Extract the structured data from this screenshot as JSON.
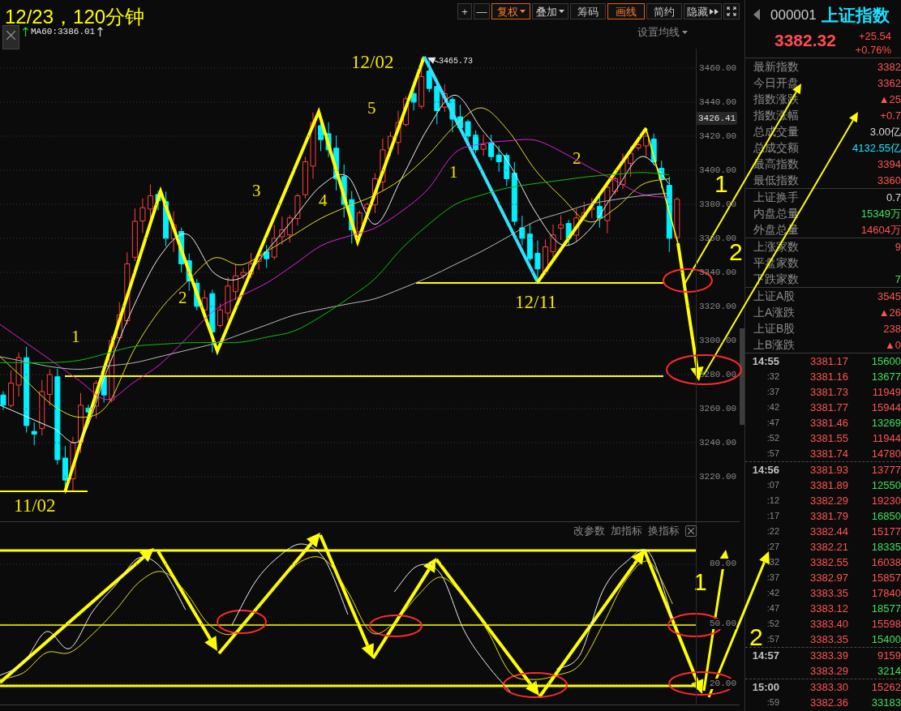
{
  "chart_title": "12/23，120分钟",
  "toolbar": {
    "buttons": [
      {
        "label": "+",
        "kind": "plain",
        "selected": false
      },
      {
        "label": "—",
        "kind": "plain",
        "selected": false
      },
      {
        "label": "复权",
        "kind": "dropdown",
        "selected": true
      },
      {
        "label": "叠加",
        "kind": "dropdown",
        "selected": false
      },
      {
        "label": "筹码",
        "kind": "plain",
        "selected": false
      },
      {
        "label": "画线",
        "kind": "plain",
        "selected": true
      },
      {
        "label": "简约",
        "kind": "plain",
        "selected": false
      },
      {
        "label": "隐藏",
        "kind": "expand",
        "selected": false
      }
    ]
  },
  "ma_legend": {
    "text": "MA60:3386.01",
    "settings_label": "设置均线"
  },
  "price_chart": {
    "chart_data": {
      "type": "line",
      "grid": true,
      "categories": [
        null,
        null,
        null,
        null,
        null,
        null,
        null,
        null,
        null,
        null,
        null,
        null,
        null,
        null,
        null,
        null,
        null,
        null,
        null,
        null,
        null,
        null,
        null,
        null,
        null,
        null,
        null
      ],
      "ylim": [
        3193.81,
        3471.43
      ],
      "yticks": [
        {
          "value": 3460,
          "label": "3460.00"
        },
        {
          "value": 3440,
          "label": "3440.00"
        },
        {
          "value": 3420,
          "label": "3420.00"
        },
        {
          "value": 3400,
          "label": "3400.00"
        },
        {
          "value": 3380,
          "label": "3380.00"
        },
        {
          "value": 3360,
          "label": "3360.00"
        },
        {
          "value": 3340,
          "label": "3340.00"
        },
        {
          "value": 3320,
          "label": "3320.00"
        },
        {
          "value": 3300,
          "label": "3300.00"
        },
        {
          "value": 3280,
          "label": "3280.00"
        },
        {
          "value": 3260,
          "label": "3260.00"
        },
        {
          "value": 3240,
          "label": "3240.00"
        },
        {
          "value": 3220,
          "label": "3220.00"
        }
      ],
      "series": [
        {
          "color": "#f0f0f0",
          "values": [
            3262,
            3255.2,
            3248.4,
            3241.6,
            3282.5,
            3320.3,
            3350.1,
            3362.4,
            3339.6,
            3336.7,
            3353.3,
            3372.1,
            3390.9,
            3396.2,
            3368.3,
            3395.1,
            3425,
            3444.1,
            3424.1,
            3404.5,
            3375.7,
            3356.2,
            3364.6,
            3388,
            3408.1,
            3392,
            null
          ]
        },
        {
          "color": "#e8e020",
          "values": [
            3290.5,
            3276,
            3261.7,
            3254.9,
            3261.8,
            3294.3,
            3318.4,
            3334.7,
            3348.5,
            3344.4,
            3352.7,
            3362.3,
            3371.8,
            3378.8,
            3385.4,
            3394.9,
            3409,
            3426.1,
            3436.6,
            3423,
            3400.2,
            3383.9,
            3369.7,
            3377.7,
            3391.6,
            3395,
            null
          ]
        },
        {
          "color": "#e020e0",
          "values": [
            3309.5,
            3298.4,
            3287.3,
            3276,
            3265.3,
            3275.5,
            3286.3,
            3301.8,
            3317.6,
            3326.2,
            3334.1,
            3344.7,
            3355.7,
            3361.2,
            3366,
            3375.8,
            3389.1,
            3410.2,
            3415.5,
            3417.3,
            3417.6,
            3410.7,
            3401.9,
            3393.8,
            3385.9,
            3384,
            null
          ]
        },
        {
          "color": "#b8b8b8",
          "values": [
            3290.5,
            3287.4,
            3284.4,
            3283.1,
            3285,
            3286.9,
            3290.6,
            3294.4,
            3298.2,
            3303.7,
            3309.4,
            3315,
            3318.4,
            3321.5,
            3324.5,
            3330.5,
            3337,
            3344.6,
            3352.4,
            3361.1,
            3370,
            3375,
            3380,
            3382.8,
            3385.1,
            3386.6,
            null
          ]
        },
        {
          "color": "#10c010",
          "values": [
            3287,
            3287,
            3287,
            3288.5,
            3292.5,
            3296.5,
            3297.8,
            3298.7,
            3298.8,
            3299,
            3302.1,
            3305.6,
            3314.2,
            3324.6,
            3336.2,
            3353.8,
            3368,
            3379.8,
            3385.5,
            3389.7,
            3392.2,
            3394.2,
            3396.3,
            3397.6,
            3398.7,
            3397.3,
            null
          ]
        }
      ]
    },
    "current_price": "3426.41"
  },
  "chart_annotations": [
    {
      "text": "12/02",
      "kind": "date"
    },
    {
      "text": "3465.73",
      "kind": "peak"
    },
    {
      "text": "5",
      "kind": "wave"
    },
    {
      "text": "3",
      "kind": "wave"
    },
    {
      "text": "4",
      "kind": "wave"
    },
    {
      "text": "1",
      "kind": "wave"
    },
    {
      "text": "2",
      "kind": "wave"
    },
    {
      "text": "1",
      "kind": "scenario"
    },
    {
      "text": "2",
      "kind": "wave"
    },
    {
      "text": "2",
      "kind": "scenario"
    },
    {
      "text": "12/11",
      "kind": "date"
    },
    {
      "text": "1",
      "kind": "wave"
    },
    {
      "text": "11/02",
      "kind": "date"
    }
  ],
  "indicator_panel": {
    "actions": [
      "改参数",
      "加指标",
      "换指标"
    ],
    "chart_data": {
      "type": "line",
      "grid": true,
      "categories": [
        null,
        null,
        null,
        null,
        null,
        null,
        null,
        null,
        null,
        null,
        null,
        null,
        null,
        null,
        null,
        null,
        null,
        null,
        null,
        null,
        null,
        null,
        null,
        null,
        null,
        null,
        null,
        null,
        null,
        null,
        null
      ],
      "ylim": [
        9.39,
        101.22
      ],
      "yticks": [
        {
          "value": 80,
          "label": "80.00"
        },
        {
          "value": 50,
          "label": "50.00"
        },
        {
          "value": 20,
          "label": "20.00"
        }
      ],
      "series": [
        {
          "color": "#f0f0f0",
          "values": [
            24.1,
            30.2,
            46.1,
            37.6,
            56.3,
            69.8,
            83.3,
            77.6,
            57.1,
            null,
            49.4,
            71,
            83.7,
            90.2,
            82.4,
            54.7,
            null,
            66.1,
            79.2,
            75.1,
            46.9,
            29.4,
            15.9,
            null,
            27.3,
            34.3,
            66.9,
            81.2,
            85.7,
            52.7,
            null
          ]
        },
        {
          "color": "#e8e020",
          "values": [
            22,
            25.3,
            35.5,
            35.5,
            44.9,
            57.1,
            71,
            76.3,
            66.1,
            49.8,
            44.9,
            57.1,
            70.2,
            81.6,
            82.4,
            66.1,
            45.7,
            50.6,
            64.1,
            73.5,
            63.3,
            46.9,
            25.3,
            22,
            24.1,
            29.4,
            49.8,
            72.2,
            81.2,
            60,
            null
          ]
        }
      ]
    },
    "annotations": [
      {
        "text": "1",
        "kind": "scenario"
      },
      {
        "text": "2",
        "kind": "scenario"
      }
    ]
  },
  "quote_panel": {
    "code": "000001",
    "name": "上证指数",
    "price": "3382.32",
    "change": "+25.54",
    "change_percent": "+0.76%",
    "stat_groups": [
      {
        "rows": [
          {
            "label": "最新指数",
            "value": "3382",
            "color": "#ff5353"
          },
          {
            "label": "今日开盘",
            "value": "3362",
            "color": "#ff5353"
          },
          {
            "label": "指数涨跌",
            "value": "▲25",
            "color": "#ff5353"
          },
          {
            "label": "指数涨幅",
            "value": "+0.7",
            "color": "#ff5353"
          },
          {
            "label": "总成交量",
            "value": "3.00亿",
            "color": "#d8d8d8"
          },
          {
            "label": "总成交额",
            "value": "4132.55亿",
            "color": "#19e3ff"
          },
          {
            "label": "最高指数",
            "value": "3394",
            "color": "#ff5353"
          },
          {
            "label": "最低指数",
            "value": "3360",
            "color": "#ff5353"
          }
        ]
      },
      {
        "rows": [
          {
            "label": "上证换手",
            "value": "0.7",
            "color": "#d8d8d8"
          },
          {
            "label": "内盘总量",
            "value": "15349万",
            "color": "#3fe05a"
          },
          {
            "label": "外盘总量",
            "value": "14604万",
            "color": "#ff5353"
          }
        ]
      },
      {
        "rows": [
          {
            "label": "上涨家数",
            "value": "9",
            "color": "#ff5353"
          },
          {
            "label": "平盘家数"
          },
          {
            "label": "下跌家数",
            "value": "7",
            "color": "#3fe05a"
          }
        ]
      },
      {
        "rows": [
          {
            "label": "上证A股",
            "value": "3545",
            "color": "#ff5353"
          },
          {
            "label": "上A涨跌",
            "value": "▲26",
            "color": "#ff5353"
          },
          {
            "label": "上证B股",
            "value": "238",
            "color": "#ff5353"
          },
          {
            "label": "上B涨跌",
            "value": "▲0",
            "color": "#ff5353"
          }
        ]
      }
    ],
    "tick_groups": [
      {
        "rows": [
          {
            "time": "14:55",
            "price": "3381.17",
            "volume": "15600",
            "color": "#3fe05a"
          },
          {
            "time": ":32",
            "price": "3381.16",
            "volume": "13677",
            "color": "#3fe05a"
          },
          {
            "time": ":37",
            "price": "3381.73",
            "volume": "11949",
            "color": "#ff5353"
          },
          {
            "time": ":42",
            "price": "3381.77",
            "volume": "15944",
            "color": "#ff5353"
          },
          {
            "time": ":47",
            "price": "3381.46",
            "volume": "13269",
            "color": "#3fe05a"
          },
          {
            "time": ":52",
            "price": "3381.55",
            "volume": "11944",
            "color": "#ff5353"
          },
          {
            "time": ":57",
            "price": "3381.74",
            "volume": "14780",
            "color": "#ff5353"
          }
        ]
      },
      {
        "rows": [
          {
            "time": "14:56",
            "price": "3381.93",
            "volume": "13777",
            "color": "#ff5353"
          },
          {
            "time": ":07",
            "price": "3381.89",
            "volume": "12550",
            "color": "#3fe05a"
          },
          {
            "time": ":12",
            "price": "3382.29",
            "volume": "19230",
            "color": "#ff5353"
          },
          {
            "time": ":17",
            "price": "3381.79",
            "volume": "16850",
            "color": "#3fe05a"
          },
          {
            "time": ":22",
            "price": "3382.44",
            "volume": "15177",
            "color": "#ff5353"
          },
          {
            "time": ":27",
            "price": "3382.21",
            "volume": "18335",
            "color": "#3fe05a"
          },
          {
            "time": ":32",
            "price": "3382.55",
            "volume": "16038",
            "color": "#ff5353"
          },
          {
            "time": ":37",
            "price": "3382.97",
            "volume": "15857",
            "color": "#ff5353"
          },
          {
            "time": ":42",
            "price": "3383.35",
            "volume": "17840",
            "color": "#ff5353"
          },
          {
            "time": ":47",
            "price": "3383.12",
            "volume": "18577",
            "color": "#3fe05a"
          },
          {
            "time": ":52",
            "price": "3383.40",
            "volume": "15598",
            "color": "#ff5353"
          },
          {
            "time": ":57",
            "price": "3383.35",
            "volume": "15400",
            "color": "#3fe05a"
          }
        ]
      },
      {
        "rows": [
          {
            "time": "14:57",
            "price": "3383.39",
            "volume": "9159",
            "color": "#ff5353"
          },
          {
            "price": "3383.29",
            "volume": "3214",
            "color": "#3fe05a"
          }
        ]
      },
      {
        "rows": [
          {
            "time": "15:00",
            "price": "3383.30",
            "volume": "15262",
            "color": "#ff5353"
          },
          {
            "time": ":59",
            "price": "3382.36",
            "volume": "33183",
            "color": "#3fe05a"
          }
        ]
      }
    ]
  }
}
